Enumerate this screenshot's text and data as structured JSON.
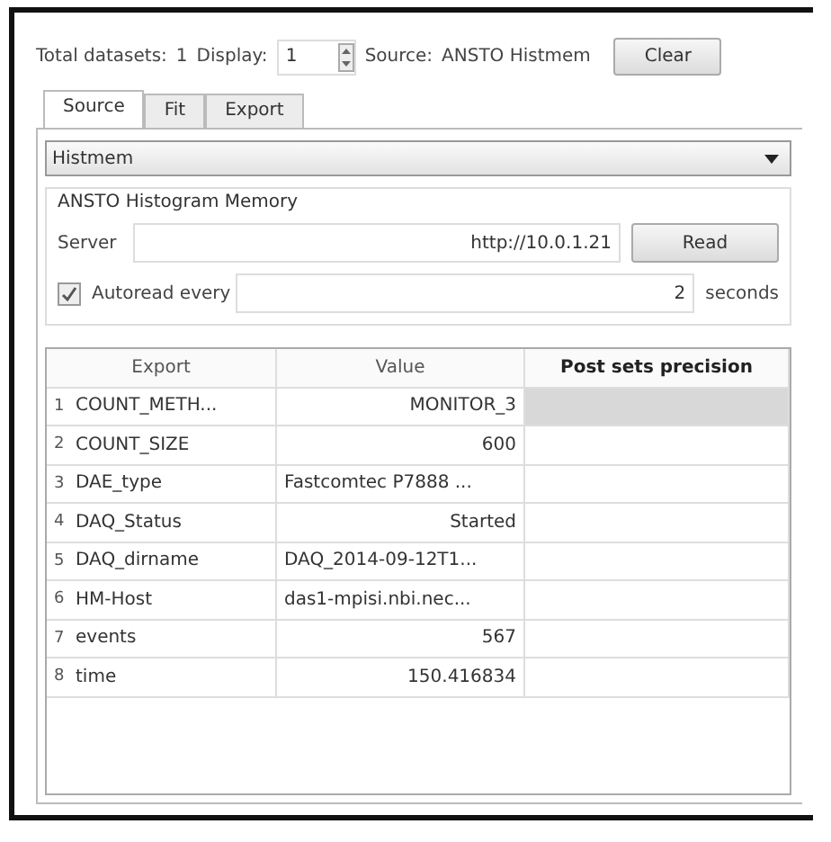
{
  "header": {
    "total_label": "Total datasets:",
    "total_value": "1",
    "display_label": "Display:",
    "display_value": "1",
    "source_label": "Source:",
    "source_value": "ANSTO Histmem",
    "clear_button": "Clear"
  },
  "tabs": [
    {
      "label": "Source",
      "selected": true
    },
    {
      "label": "Fit",
      "selected": false
    },
    {
      "label": "Export",
      "selected": false
    }
  ],
  "source_select": {
    "value": "Histmem"
  },
  "group": {
    "title": "ANSTO Histogram Memory",
    "server_label": "Server",
    "server_value": "http://10.0.1.21",
    "read_button": "Read",
    "autoread_label": "Autoread every",
    "autoread_checked": true,
    "autoread_value": "2",
    "autoread_unit": "seconds"
  },
  "table": {
    "columns": [
      "Export",
      "Value",
      "Post sets precision"
    ],
    "rows": [
      {
        "index": "1",
        "export": "COUNT_METH...",
        "value": "MONITOR_3",
        "kind": "whole",
        "selected": true
      },
      {
        "index": "2",
        "export": "COUNT_SIZE",
        "value": "600",
        "kind": "whole",
        "selected": false
      },
      {
        "index": "3",
        "export": "DAE_type",
        "value": "Fastcomtec P7888 ...",
        "kind": "elided",
        "selected": false
      },
      {
        "index": "4",
        "export": "DAQ_Status",
        "value": "Started",
        "kind": "whole",
        "selected": false
      },
      {
        "index": "5",
        "export": "DAQ_dirname",
        "value": "DAQ_2014-09-12T1...",
        "kind": "elided",
        "selected": false
      },
      {
        "index": "6",
        "export": "HM-Host",
        "value": "das1-mpisi.nbi.nec...",
        "kind": "elided",
        "selected": false
      },
      {
        "index": "7",
        "export": "events",
        "value": "567",
        "kind": "whole",
        "selected": false
      },
      {
        "index": "8",
        "export": "time",
        "value": "150.416834",
        "kind": "whole",
        "selected": false
      }
    ]
  }
}
